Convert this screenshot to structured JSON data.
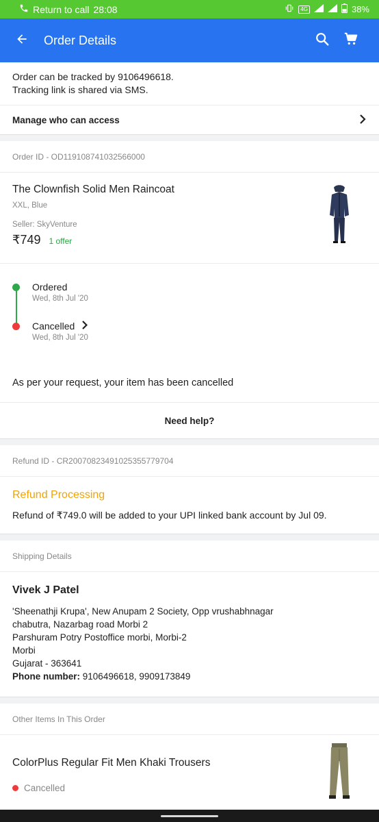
{
  "status_bar": {
    "call_text": "Return to call",
    "time": "28:08",
    "network_label": "4G",
    "battery": "38%"
  },
  "header": {
    "title": "Order Details",
    "back_icon": "arrow-left-icon",
    "search_icon": "search-icon",
    "cart_icon": "cart-icon"
  },
  "tracking": {
    "line1": "Order can be tracked by 9106496618.",
    "line2": "Tracking link is shared via SMS.",
    "manage_label": "Manage who can access"
  },
  "order": {
    "order_id": "Order ID - OD119108741032566000",
    "product_name": "The Clownfish Solid Men Raincoat",
    "variant": "XXL, Blue",
    "seller": "Seller: SkyVenture",
    "price": "₹749",
    "offer": "1 offer",
    "timeline": [
      {
        "label": "Ordered",
        "date": "Wed, 8th Jul '20",
        "color": "#2ea84a"
      },
      {
        "label": "Cancelled",
        "date": "Wed, 8th Jul '20",
        "color": "#ee3b3b"
      }
    ],
    "cancel_message": "As per your request, your item has been cancelled",
    "help_label": "Need help?"
  },
  "refund": {
    "refund_id": "Refund ID - CR2007082349102535577​9704",
    "status": "Refund Processing",
    "message": "Refund of ₹749.0 will be added to your UPI linked bank account by Jul 09."
  },
  "shipping": {
    "header": "Shipping Details",
    "name": "Vivek J Patel",
    "address": [
      "'Sheenathji Krupa', New Anupam 2 Society, Opp vrushabhnagar",
      "chabutra, Nazarbag road Morbi 2",
      "Parshuram Potry Postoffice morbi, Morbi-2",
      "Morbi",
      "Gujarat - 363641"
    ],
    "phone_label": "Phone number:",
    "phone_value": "9106496618, 9909173849"
  },
  "other_items": {
    "header": "Other Items In This Order",
    "items": [
      {
        "name": "ColorPlus Regular Fit Men Khaki Trousers",
        "status": "Cancelled"
      }
    ]
  },
  "colors": {
    "primary": "#2874f0",
    "status_bar": "#56c832",
    "success": "#26a541",
    "refund": "#f0a30a",
    "cancelled": "#ee3b3b"
  }
}
